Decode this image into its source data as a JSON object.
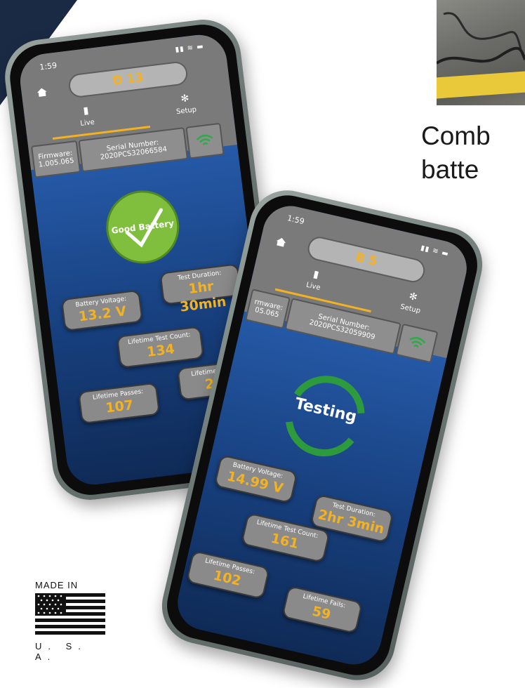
{
  "headline": {
    "line1": "Comb",
    "line2": "batte"
  },
  "badge": {
    "made_in": "MADE IN",
    "country": "U. S. A."
  },
  "colors": {
    "accent": "#f3b221",
    "pass_green": "#7fbf3d",
    "testing_green": "#2e9a3e",
    "navy": "#1b2a44"
  },
  "phone1": {
    "status_time": "1:59",
    "device": "D 13",
    "tabs": {
      "live": "Live",
      "setup": "Setup"
    },
    "firmware": {
      "label": "Firmware:",
      "value": "1.005.065"
    },
    "serial": {
      "label": "Serial Number:",
      "value": "2020PCS32066584"
    },
    "status": "Good Battery",
    "battery_voltage": {
      "label": "Battery Voltage:",
      "value": "13.2 V"
    },
    "test_duration": {
      "label": "Test Duration:",
      "value": "1hr 30min"
    },
    "lifetime_test_count": {
      "label": "Lifetime Test Count:",
      "value": "134"
    },
    "lifetime_passes": {
      "label": "Lifetime Passes:",
      "value": "107"
    },
    "lifetime_fails": {
      "label": "Lifetime Fails:",
      "value": "27"
    }
  },
  "phone2": {
    "status_time": "1:59",
    "device": "B 5",
    "tabs": {
      "live": "Live",
      "setup": "Setup"
    },
    "firmware": {
      "label": "rmware:",
      "value": "05.065"
    },
    "serial": {
      "label": "Serial Number:",
      "value": "2020PCS32059909"
    },
    "status": "Testing",
    "battery_voltage": {
      "label": "Battery Voltage:",
      "value": "14.99 V"
    },
    "test_duration": {
      "label": "Test Duration:",
      "value": "2hr 3min"
    },
    "lifetime_test_count": {
      "label": "Lifetime Test Count:",
      "value": "161"
    },
    "lifetime_passes": {
      "label": "Lifetime Passes:",
      "value": "102"
    },
    "lifetime_fails": {
      "label": "Lifetime Fails:",
      "value": "59"
    }
  }
}
